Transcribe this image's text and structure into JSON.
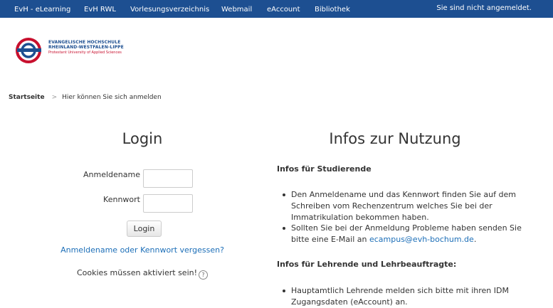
{
  "nav": {
    "items": [
      {
        "label": "EvH - eLearning"
      },
      {
        "label": "EvH RWL"
      },
      {
        "label": "Vorlesungsverzeichnis"
      },
      {
        "label": "Webmail"
      },
      {
        "label": "eAccount"
      },
      {
        "label": "Bibliothek"
      }
    ],
    "login_status": "Sie sind nicht angemeldet."
  },
  "logo": {
    "line1": "EVANGELISCHE HOCHSCHULE",
    "line2": "RHEINLAND-WESTFALEN-LIPPE",
    "line3": "Protestant University of Applied Sciences"
  },
  "breadcrumb": {
    "home": "Startseite",
    "separator": ">",
    "current": "Hier können Sie sich anmelden"
  },
  "login": {
    "title": "Login",
    "username_label": "Anmeldename",
    "username_value": "",
    "password_label": "Kennwort",
    "password_value": "",
    "button_label": "Login",
    "forgot_link": "Anmeldename oder Kennwort vergessen?",
    "cookies_text": "Cookies müssen aktiviert sein!",
    "help_icon": "?"
  },
  "info": {
    "title": "Infos zur Nutzung",
    "students_heading": "Infos für Studierende",
    "students_item1": "Den Anmeldename und das Kennwort finden Sie auf dem Schreiben vom Rechenzentrum welches Sie bei der Immatrikulation bekommen haben.",
    "students_item2_text": "Sollten Sie bei der Anmeldung Probleme haben senden Sie bitte eine E-Mail an ",
    "students_item2_email": "ecampus@evh-bochum.de",
    "students_item2_end": ".",
    "teachers_heading": "Infos für Lehrende und Lehrbeauftragte:",
    "teachers_item1": "Hauptamtlich Lehrende melden sich bitte mit ihren IDM Zugangsdaten (eAccount) an."
  },
  "colors": {
    "navbar": "#1d4f91",
    "link": "#1d6fb8",
    "logo_blue": "#1d4f91",
    "logo_red": "#c8102e"
  }
}
